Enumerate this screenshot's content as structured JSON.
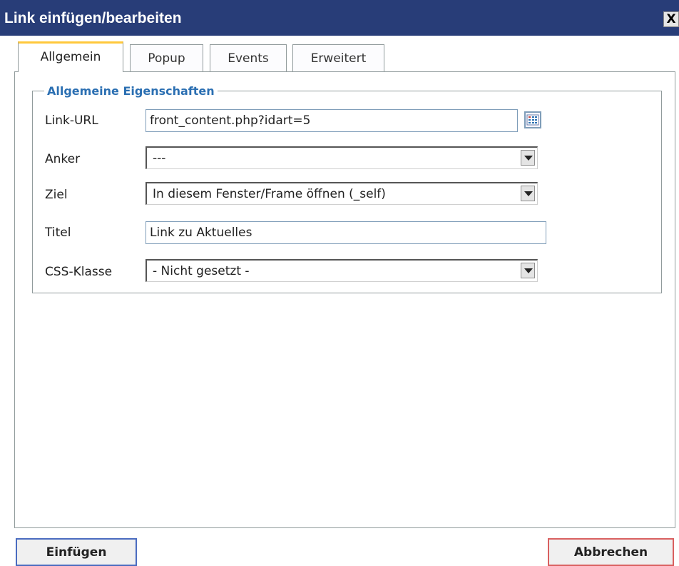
{
  "window": {
    "title": "Link einfügen/bearbeiten",
    "close_label": "X"
  },
  "tabs": [
    {
      "label": "Allgemein",
      "active": true
    },
    {
      "label": "Popup",
      "active": false
    },
    {
      "label": "Events",
      "active": false
    },
    {
      "label": "Erweitert",
      "active": false
    }
  ],
  "general": {
    "legend": "Allgemeine Eigenschaften",
    "link_url": {
      "label": "Link-URL",
      "value": "front_content.php?idart=5"
    },
    "anchor": {
      "label": "Anker",
      "value": "---"
    },
    "target": {
      "label": "Ziel",
      "value": "In diesem Fenster/Frame öffnen (_self)"
    },
    "title": {
      "label": "Titel",
      "value": "Link zu Aktuelles"
    },
    "css_class": {
      "label": "CSS-Klasse",
      "value": "- Nicht gesetzt -"
    }
  },
  "buttons": {
    "insert": "Einfügen",
    "cancel": "Abbrechen"
  },
  "colors": {
    "titlebar": "#283d78",
    "legend": "#2b6fb2",
    "active_tab_accent": "#ffc83c"
  }
}
